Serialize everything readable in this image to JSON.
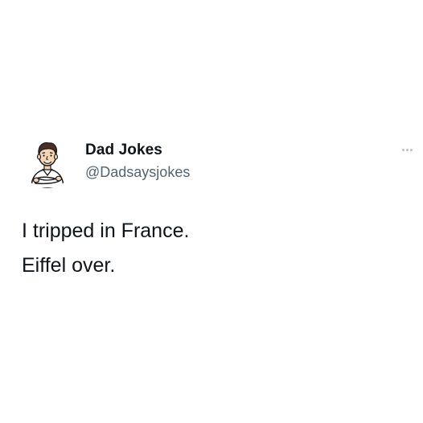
{
  "tweet": {
    "display_name": "Dad Jokes",
    "handle": "@Dadsaysjokes",
    "avatar_icon": "cartoon-man-arms-crossed-icon",
    "more_icon": "more-options-icon",
    "lines": [
      "I tripped in France.",
      "Eiffel over."
    ]
  },
  "colors": {
    "text": "#0f1419",
    "secondary_text": "#536471",
    "background": "#ffffff"
  }
}
